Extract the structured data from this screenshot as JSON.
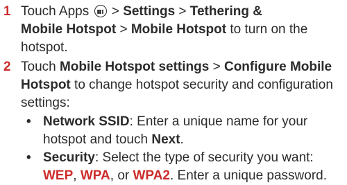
{
  "steps": [
    {
      "number": "1",
      "parts": {
        "t1": "Touch Apps",
        "t2": " > ",
        "settings": "Settings",
        "t3": " > ",
        "tether1": "Tethering &",
        "tether2": "Mobile Hotspot",
        "t4": " > ",
        "hotspot": "Mobile Hotspot",
        "t5": " to turn on the",
        "t6": "hotspot."
      }
    },
    {
      "number": "2",
      "parts": {
        "t1": "Touch ",
        "hs_settings": "Mobile Hotspot settings",
        "t2": " > ",
        "configure1": "Configure Mobile",
        "configure2": "Hotspot",
        "t3": " to change hotspot security and configuration",
        "t4": "settings:"
      }
    }
  ],
  "bullets": [
    {
      "dot": "•",
      "label": "Network SSID",
      "t1": ": Enter a unique name for your",
      "t2": "hotspot and touch ",
      "next": "Next",
      "t3": "."
    },
    {
      "dot": "•",
      "label": "Security",
      "t1": ": Select the type of security you want:",
      "wep": "WEP",
      "c1": ", ",
      "wpa": "WPA",
      "c2": ", or ",
      "wpa2": "WPA2",
      "t2": ". Enter a unique password."
    }
  ],
  "icons": {
    "apps": "apps-icon"
  },
  "colors": {
    "step_number": "#cc2c2c",
    "text": "#2b2b2b"
  }
}
